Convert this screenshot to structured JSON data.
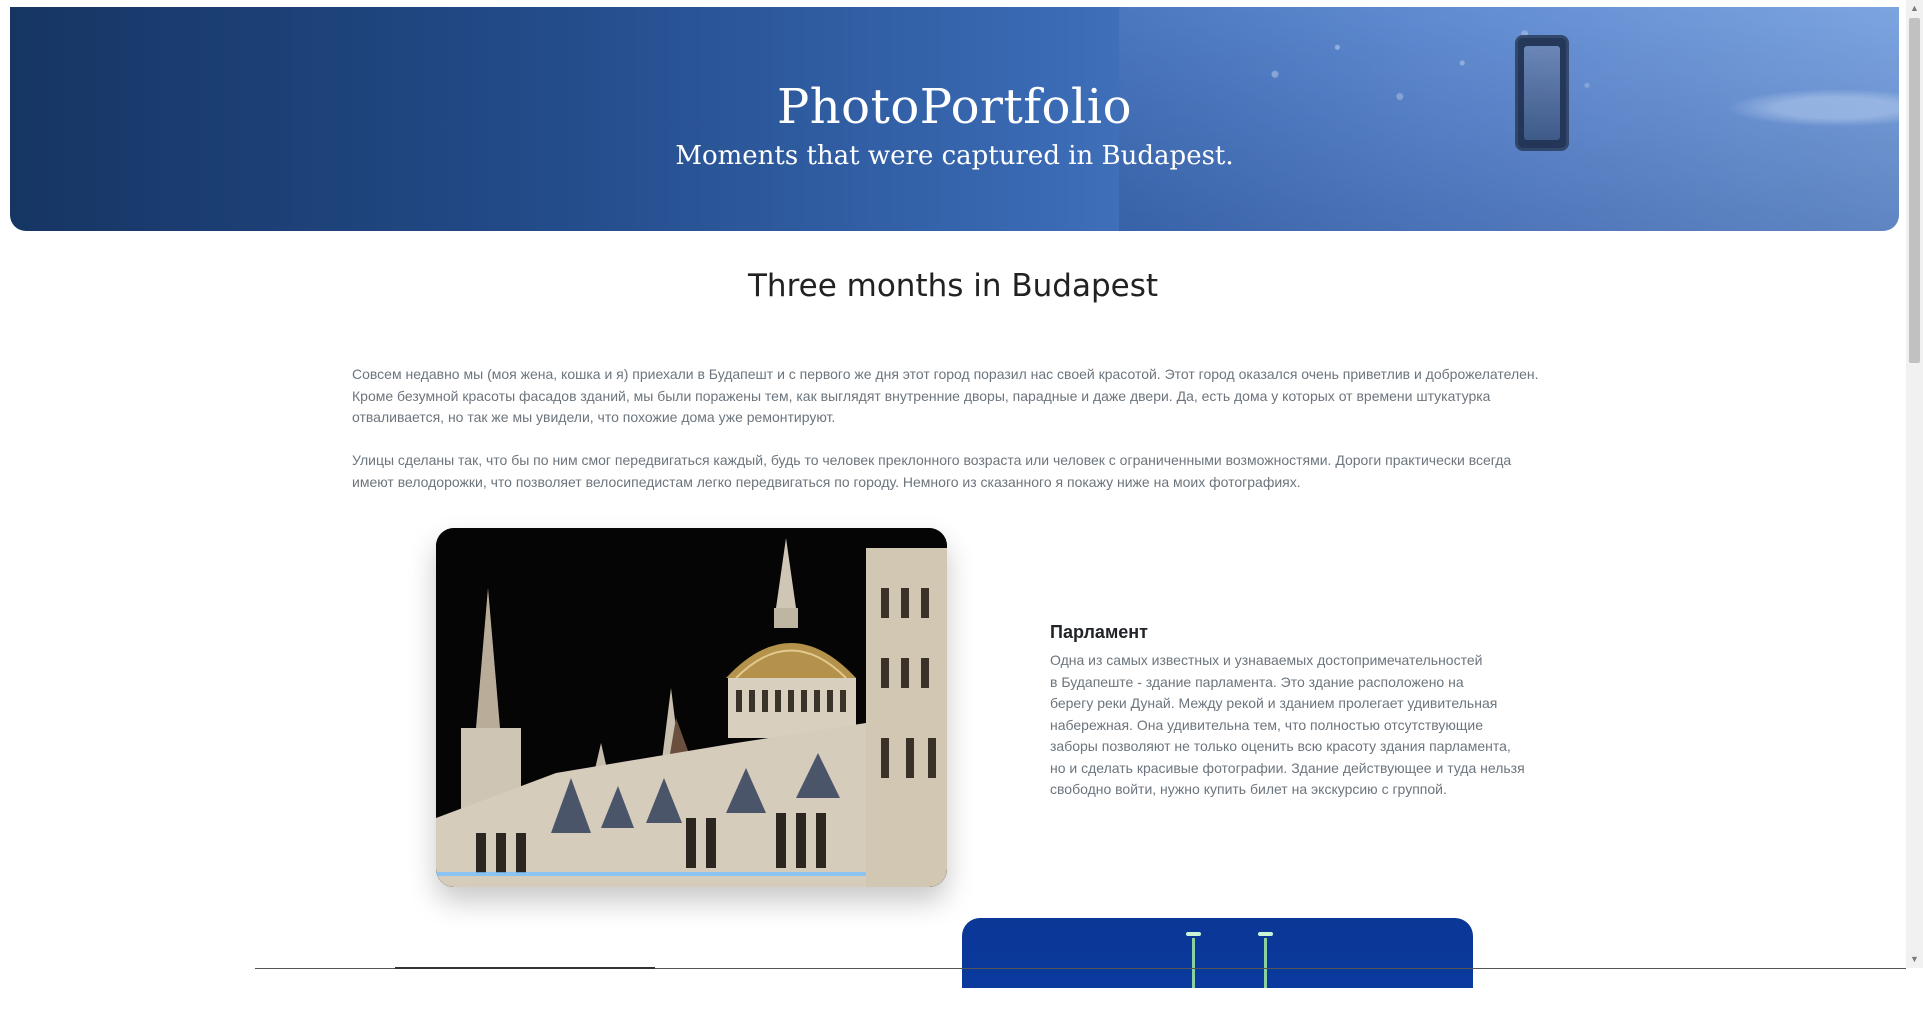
{
  "header": {
    "title": "PhotoPortfolio",
    "subtitle": "Moments that were captured in Budapest."
  },
  "section": {
    "title": "Three months in Budapest",
    "paragraphs": [
      "Совсем недавно мы (моя жена, кошка и я) приехали в Будапешт и с первого же дня этот город поразил нас своей красотой. Этот город оказался очень приветлив и доброжелателен. Кроме безумной красоты фасадов зданий, мы были поражены тем, как выглядят внутренние дворы, парадные и даже двери. Да, есть дома у которых от времени штукатурка отваливается, но так же мы увидели, что похожие дома уже ремонтируют.",
      "Улицы сделаны так, что бы по ним смог передвигаться каждый, будь то человек преклонного возраста или человек с ограниченными возможностями. Дороги практически всегда имеют велодорожки, что позволяет велосипедистам легко передвигаться по городу. Немного из сказанного я покажу ниже на моих фотографиях."
    ]
  },
  "gallery": [
    {
      "title": "Парламент",
      "text": "Одна из самых известных и узнаваемых достопримечательностей\nв Будапеште - здание парламента. Это здание расположено на\nберегу реки Дунай. Между рекой и зданием пролегает удивительная\nнабережная. Она удивительна тем, что полностью отсутствующие\nзаборы позволяют не только оценить всю красоту здания парламента,\nно и сделать красивые фотографии. Здание действующее и туда нельзя\nсвободно войти, нужно купить билет на экскурсию с группой."
    }
  ],
  "scrollbar": {
    "up_icon": "▲",
    "down_icon": "▼"
  }
}
